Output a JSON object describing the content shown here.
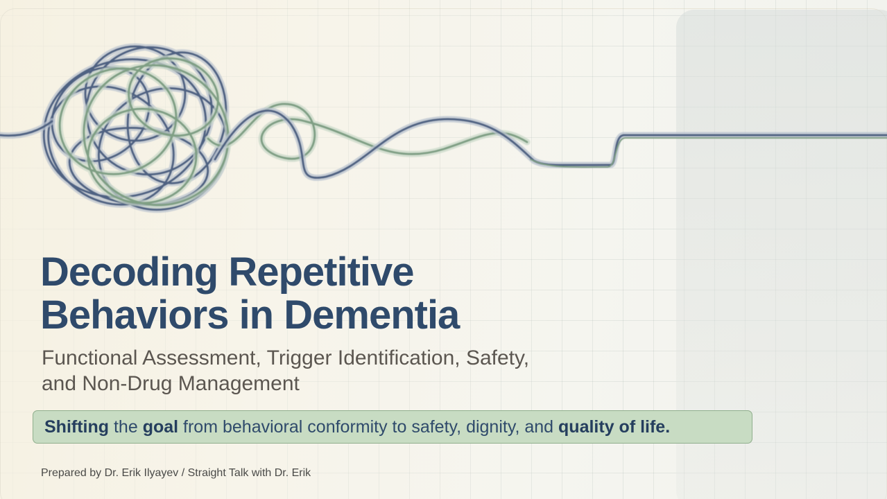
{
  "slide": {
    "title_line1": "Decoding Repetitive",
    "title_line2": "Behaviors in Dementia",
    "subtitle_line1": "Functional Assessment, Trigger Identification, Safety,",
    "subtitle_line2": "and Non-Drug Management",
    "callout": {
      "bold1": "Shifting",
      "text1": " the ",
      "bold2": "goal",
      "text2": " from behavioral conformity to safety, dignity, and ",
      "bold3": "quality of life."
    },
    "footer": "Prepared by Dr. Erik Ilyayev / Straight Talk with Dr. Erik"
  },
  "colors": {
    "title": "#2f4a6b",
    "subtitle": "#5b5650",
    "callout_bg": "#c8dcc3",
    "callout_border": "#8fae8c",
    "line_blue": "#4f6282",
    "line_green": "#7f9f84"
  },
  "icons": {
    "hero_graphic": "tangled-line-to-straight-line-illustration"
  }
}
